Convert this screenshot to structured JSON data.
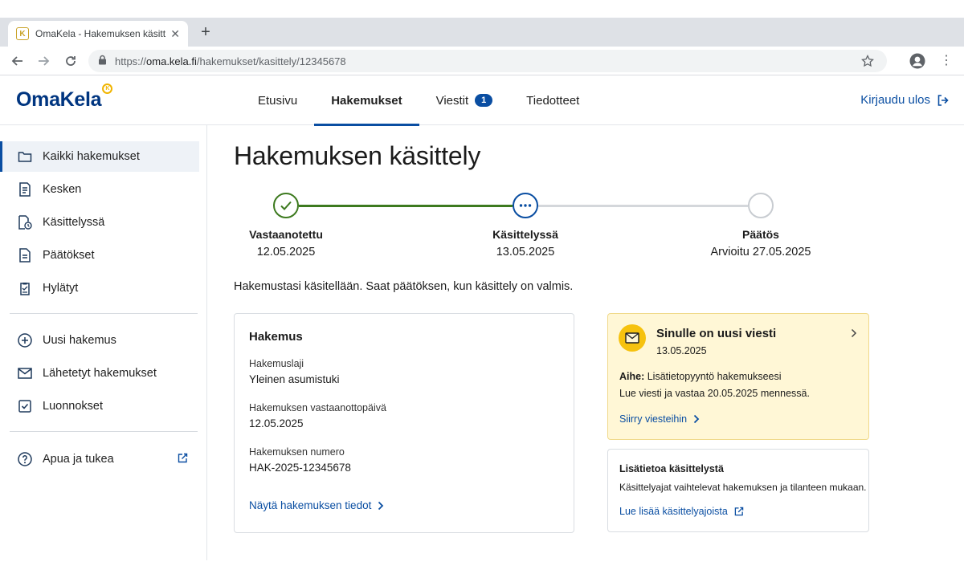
{
  "browser": {
    "tab_title": "OmaKela - Hakemuksen käsittely",
    "url_prefix": "https://",
    "url_host": "oma.kela.fi",
    "url_path": "/hakemukset/kasittely/12345678"
  },
  "header": {
    "logo": "OmaKela",
    "nav": [
      {
        "label": "Etusivu"
      },
      {
        "label": "Hakemukset"
      },
      {
        "label": "Viestit",
        "badge": "1"
      },
      {
        "label": "Tiedotteet"
      }
    ],
    "logout": "Kirjaudu ulos"
  },
  "sidebar": {
    "items": [
      {
        "label": "Kaikki hakemukset",
        "icon": "folder-icon"
      },
      {
        "label": "Kesken",
        "icon": "document-lines-icon"
      },
      {
        "label": "Käsittelyssä",
        "icon": "document-clock-icon"
      },
      {
        "label": "Päätökset",
        "icon": "document-icon"
      },
      {
        "label": "Hylätyt",
        "icon": "clipboard-icon"
      },
      {
        "label": "Uusi hakemus",
        "icon": "plus-circle-icon"
      },
      {
        "label": "Lähetetyt hakemukset",
        "icon": "envelope-icon"
      },
      {
        "label": "Luonnokset",
        "icon": "checkbox-icon"
      },
      {
        "label": "Apua ja tukea",
        "icon": "help-icon"
      }
    ]
  },
  "main": {
    "title": "Hakemuksen käsittely",
    "steps": [
      {
        "label": "Vastaanotettu",
        "date": "12.05.2025",
        "state": "done"
      },
      {
        "label": "Käsittelyssä",
        "date": "13.05.2025",
        "state": "current"
      },
      {
        "label": "Päätös",
        "date": "Arvioitu 27.05.2025",
        "state": "pending"
      }
    ],
    "status_text": "Hakemustasi käsitellään. Saat päätöksen, kun käsittely on valmis.",
    "application": {
      "heading": "Hakemus",
      "fields": [
        {
          "label": "Hakemuslaji",
          "value": "Yleinen asumistuki"
        },
        {
          "label": "Hakemuksen vastaanottopäivä",
          "value": "12.05.2025"
        },
        {
          "label": "Hakemuksen numero",
          "value": "HAK-2025-12345678"
        }
      ],
      "link": "Näytä hakemuksen tiedot"
    },
    "message": {
      "title": "Sinulle on uusi viesti",
      "date": "13.05.2025",
      "subject_label": "Aihe:",
      "subject": "Lisätietopyyntö hakemukseesi",
      "body": "Lue viesti ja vastaa 20.05.2025 mennessä.",
      "link": "Siirry viesteihin"
    },
    "info": {
      "heading": "Lisätietoa käsittelystä",
      "body": "Käsittelyajat vaihtelevat hakemuksen ja tilanteen mukaan.",
      "link": "Lue lisää käsittelyajoista"
    }
  },
  "colors": {
    "brand": "#003580",
    "accent": "#0a4ea2",
    "done": "#3d7a1f",
    "message_bg": "#fff7d6"
  }
}
